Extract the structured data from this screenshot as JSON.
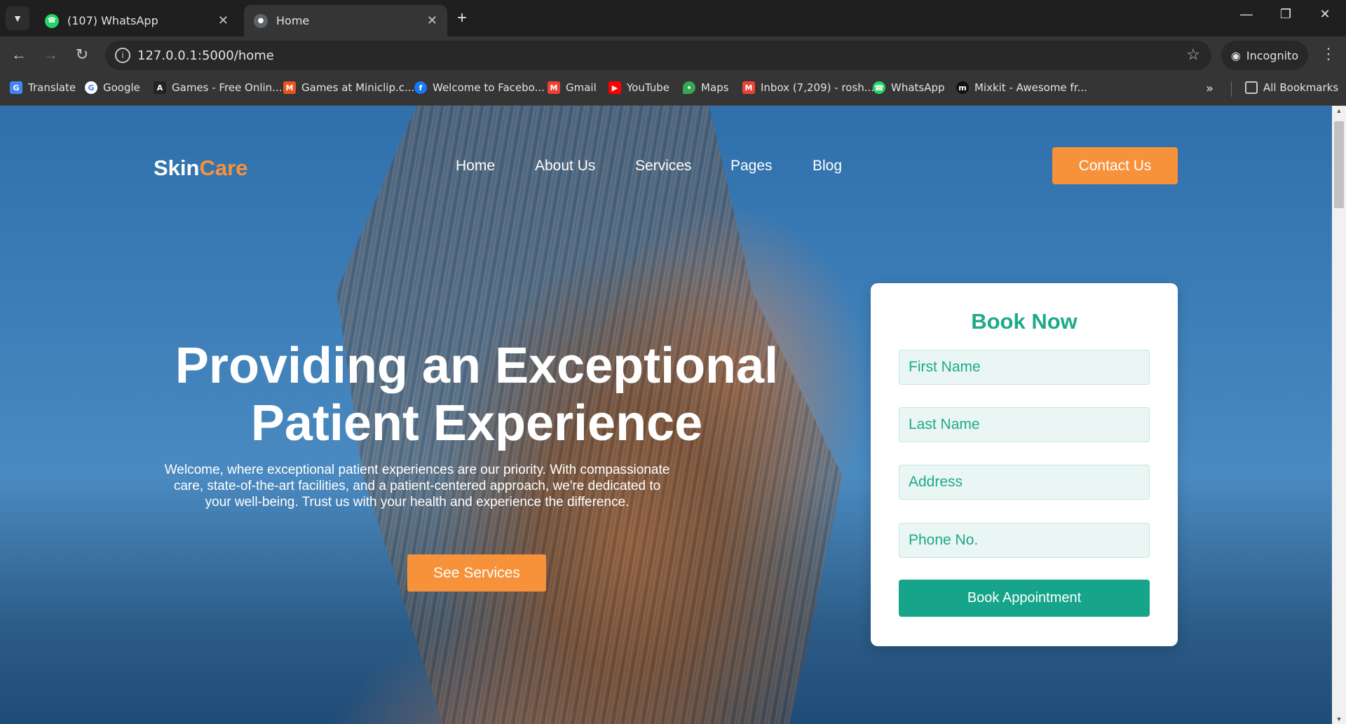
{
  "browser": {
    "tabs": [
      {
        "title": "(107) WhatsApp",
        "favicon": "whatsapp-icon",
        "active": false
      },
      {
        "title": "Home",
        "favicon": "globe-icon",
        "active": true
      }
    ],
    "url": "127.0.0.1:5000/home",
    "incognito_label": "Incognito",
    "bookmarks": [
      {
        "label": "Translate",
        "icon": "translate-icon",
        "color": "#4285f4"
      },
      {
        "label": "Google",
        "icon": "google-icon",
        "color": "#ffffff"
      },
      {
        "label": "Games - Free Onlin...",
        "icon": "games-icon",
        "color": "#222222"
      },
      {
        "label": "Games at Miniclip.c...",
        "icon": "miniclip-icon",
        "color": "#e8541e"
      },
      {
        "label": "Welcome to Facebo...",
        "icon": "facebook-icon",
        "color": "#1877f2"
      },
      {
        "label": "Gmail",
        "icon": "gmail-icon",
        "color": "#ea4335"
      },
      {
        "label": "YouTube",
        "icon": "youtube-icon",
        "color": "#ff0000"
      },
      {
        "label": "Maps",
        "icon": "maps-icon",
        "color": "#34a853"
      },
      {
        "label": "Inbox (7,209) - rosh...",
        "icon": "gmail-icon",
        "color": "#ea4335"
      },
      {
        "label": "WhatsApp",
        "icon": "whatsapp-icon",
        "color": "#25d366"
      },
      {
        "label": "Mixkit - Awesome fr...",
        "icon": "mixkit-icon",
        "color": "#111111"
      }
    ],
    "all_bookmarks_label": "All Bookmarks"
  },
  "site": {
    "logo_part1": "Skin",
    "logo_part2": "Care",
    "nav": [
      "Home",
      "About Us",
      "Services",
      "Pages",
      "Blog"
    ],
    "contact_button": "Contact Us",
    "hero_title_line1": "Providing an Exceptional",
    "hero_title_line2": "Patient Experience",
    "hero_text": "Welcome, where exceptional patient experiences are our priority. With compassionate care, state-of-the-art facilities, and a patient-centered approach, we're dedicated to your well-being. Trust us with your health and experience the difference.",
    "services_button": "See Services",
    "booking": {
      "title": "Book Now",
      "first_name_placeholder": "First Name",
      "last_name_placeholder": "Last Name",
      "address_placeholder": "Address",
      "phone_placeholder": "Phone No.",
      "submit": "Book Appointment"
    }
  },
  "colors": {
    "accent_orange": "#f7923a",
    "accent_green": "#1ea98a"
  }
}
